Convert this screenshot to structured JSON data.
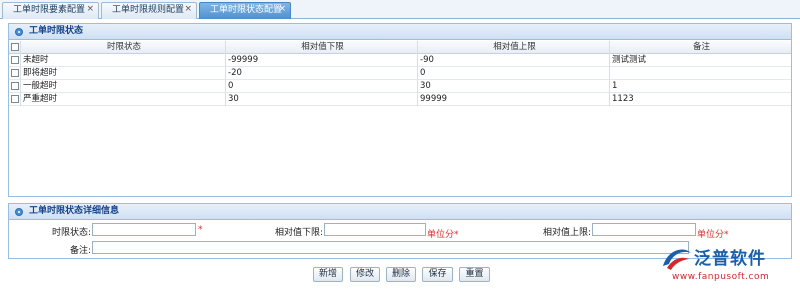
{
  "tabs": [
    {
      "label": "工单时限要素配置",
      "close": "×"
    },
    {
      "label": "工单时限规则配置",
      "close": "×"
    },
    {
      "label": "工单时限状态配置",
      "close": "×"
    }
  ],
  "status_panel": {
    "title": "工单时限状态",
    "columns": [
      "时限状态",
      "相对值下限",
      "相对值上限",
      "备注"
    ],
    "rows": [
      {
        "status": "未超时",
        "lower": "-99999",
        "upper": "-90",
        "remark": "测试测试"
      },
      {
        "status": "即将超时",
        "lower": "-20",
        "upper": "0",
        "remark": ""
      },
      {
        "status": "一般超时",
        "lower": "0",
        "upper": "30",
        "remark": "1"
      },
      {
        "status": "严重超时",
        "lower": "30",
        "upper": "99999",
        "remark": "1123"
      }
    ]
  },
  "detail_panel": {
    "title": "工单时限状态详细信息",
    "status_label": "时限状态:",
    "status_required": "*",
    "lower_label": "相对值下限:",
    "lower_unit": "单位分*",
    "upper_label": "相对值上限:",
    "upper_unit": "单位分*",
    "remark_label": "备注:"
  },
  "buttons": {
    "add": "新增",
    "edit": "修改",
    "delete": "删除",
    "save": "保存",
    "reset": "重置"
  },
  "logo": {
    "name": "泛普软件",
    "url": "www.fanpusoft.com",
    "brand_blue": "#1b5faa",
    "brand_red": "#d02a2a"
  }
}
